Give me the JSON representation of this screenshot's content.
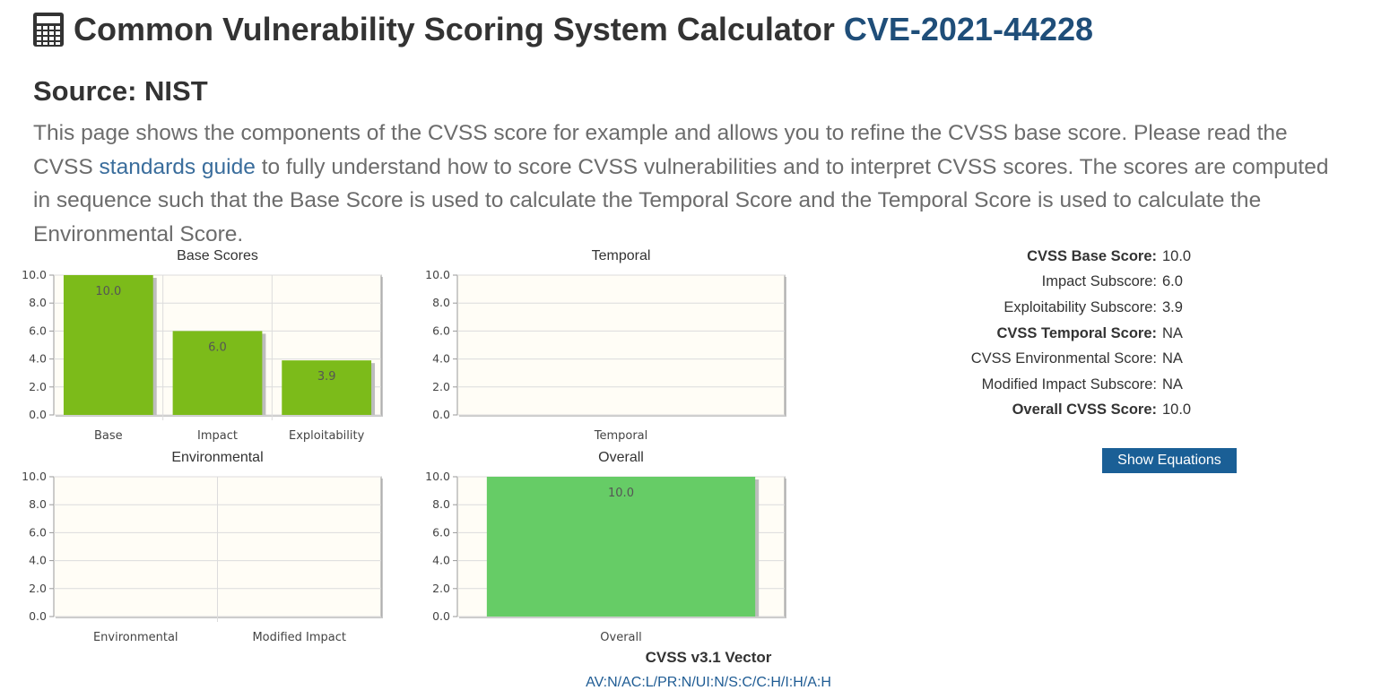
{
  "header": {
    "title": "Common Vulnerability Scoring System Calculator",
    "cve_id": "CVE-2021-44228",
    "icon": "calculator-icon"
  },
  "source": "Source: NIST",
  "description": {
    "before_link": "This page shows the components of the CVSS score for example and allows you to refine the CVSS base score. Please read the CVSS ",
    "link_text": "standards guide",
    "after_link": " to fully understand how to score CVSS vulnerabilities and to interpret CVSS scores. The scores are computed in sequence such that the Base Score is used to calculate the Temporal Score and the Temporal Score is used to calculate the Environmental Score."
  },
  "chart_data": [
    {
      "type": "bar",
      "title": "Base Scores",
      "categories": [
        "Base",
        "Impact",
        "Exploitability"
      ],
      "values": [
        10.0,
        6.0,
        3.9
      ],
      "labels": [
        "10.0",
        "6.0",
        "3.9"
      ],
      "ylim": [
        0,
        10
      ],
      "yticks": [
        "0.0",
        "2.0",
        "4.0",
        "6.0",
        "8.0",
        "10.0"
      ],
      "bar_color": "#7cbb1a",
      "grid": true
    },
    {
      "type": "bar",
      "title": "Temporal",
      "categories": [
        "Temporal"
      ],
      "values": [
        null
      ],
      "labels": [
        ""
      ],
      "ylim": [
        0,
        10
      ],
      "yticks": [
        "0.0",
        "2.0",
        "4.0",
        "6.0",
        "8.0",
        "10.0"
      ],
      "bar_color": "#7cbb1a",
      "grid": true
    },
    {
      "type": "bar",
      "title": "Environmental",
      "categories": [
        "Environmental",
        "Modified Impact"
      ],
      "values": [
        null,
        null
      ],
      "labels": [
        "",
        ""
      ],
      "ylim": [
        0,
        10
      ],
      "yticks": [
        "0.0",
        "2.0",
        "4.0",
        "6.0",
        "8.0",
        "10.0"
      ],
      "bar_color": "#7cbb1a",
      "grid": true
    },
    {
      "type": "bar",
      "title": "Overall",
      "categories": [
        "Overall"
      ],
      "values": [
        10.0
      ],
      "labels": [
        "10.0"
      ],
      "ylim": [
        0,
        10
      ],
      "yticks": [
        "0.0",
        "2.0",
        "4.0",
        "6.0",
        "8.0",
        "10.0"
      ],
      "bar_color": "#66cc66",
      "grid": true
    }
  ],
  "scores": [
    {
      "label": "CVSS Base Score:",
      "value": "10.0",
      "bold": true
    },
    {
      "label": "Impact Subscore:",
      "value": "6.0",
      "bold": false
    },
    {
      "label": "Exploitability Subscore:",
      "value": "3.9",
      "bold": false
    },
    {
      "label": "CVSS Temporal Score:",
      "value": "NA",
      "bold": true
    },
    {
      "label": "CVSS Environmental Score:",
      "value": "NA",
      "bold": false
    },
    {
      "label": "Modified Impact Subscore:",
      "value": "NA",
      "bold": false
    },
    {
      "label": "Overall CVSS Score:",
      "value": "10.0",
      "bold": true
    }
  ],
  "show_equations_label": "Show Equations",
  "vector": {
    "title": "CVSS v3.1 Vector",
    "string": "AV:N/AC:L/PR:N/UI:N/S:C/C:H/I:H/A:H"
  }
}
